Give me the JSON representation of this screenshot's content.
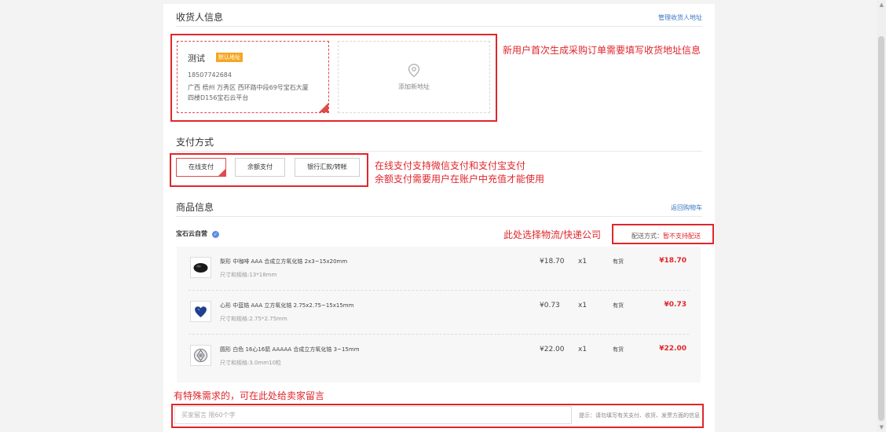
{
  "receiver": {
    "title": "收货人信息",
    "manage_link": "管理收货人地址",
    "address": {
      "name": "测试",
      "default_badge": "默认地址",
      "phone": "18507742684",
      "line1": "广西 梧州 万秀区   西环路中段69号宝石大厦",
      "line2": "四楼D156宝石云平台"
    },
    "add_new_label": "添加新地址"
  },
  "payment": {
    "title": "支付方式",
    "options": [
      "在线支付",
      "余额支付",
      "银行汇款/转帐"
    ],
    "selected": "在线支付"
  },
  "goods": {
    "title": "商品信息",
    "back_link": "返回购物车",
    "store_name": "宝石云自营",
    "shipping_label": "配送方式：",
    "shipping_value": "暂不支持配送",
    "items": [
      {
        "name": "梨形 中咖啡 AAA 合成立方氧化锆 2x3~15x20mm",
        "spec": "尺寸和规格:13*18mm",
        "price": "¥18.70",
        "qty": "x1",
        "stock": "有货",
        "total": "¥18.70",
        "color": "#1a1a1a"
      },
      {
        "name": "心形 中蓝锆 AAA 立方氧化锆 2.75x2.75~15x15mm",
        "spec": "尺寸和规格:2.75*2.75mm",
        "price": "¥0.73",
        "qty": "x1",
        "stock": "有货",
        "total": "¥0.73",
        "color": "#1f3f8f"
      },
      {
        "name": "圆形 白色 16心16箭 AAAAA 合成立方氧化锆 3~15mm",
        "spec": "尺寸和规格:3.0mm10粒",
        "price": "¥22.00",
        "qty": "x1",
        "stock": "有货",
        "total": "¥22.00",
        "color": "#c8ccd4"
      }
    ]
  },
  "message": {
    "placeholder": "买家留言 限60个字",
    "tip": "提示：请勿填写有关支付、收货、发票方面的信息"
  },
  "annotations": {
    "address": "新用户首次生成采购订单需要填写收货地址信息",
    "pay1": "在线支付支持微信支付和支付宝支付",
    "pay2": "余额支付需要用户在账户中充值才能使用",
    "logistics": "此处选择物流/快递公司",
    "message": "有特殊需求的，可在此处给卖家留言"
  },
  "colors": {
    "accent": "#e0262b",
    "badge": "#f5a623",
    "link": "#3a78c2"
  }
}
